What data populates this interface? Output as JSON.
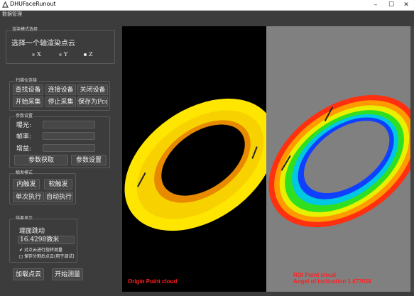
{
  "window": {
    "title": "DHUFaceRunout"
  },
  "menu": {
    "items": [
      "数据管理"
    ]
  },
  "render_mode": {
    "group_title": "渲染模式选择",
    "prompt": "选择一个轴渲染点云",
    "options": [
      "X",
      "Y",
      "Z"
    ],
    "selected": "Z"
  },
  "scanner": {
    "group_title": "扫描仪连接",
    "buttons": {
      "find": "查找设备",
      "connect": "连接设备",
      "close": "关闭设备",
      "start_capture": "开始采集",
      "stop_capture": "停止采集",
      "save_pcd": "保存为Pcd"
    }
  },
  "params": {
    "group_title": "参数设置",
    "exposure_label": "曝光:",
    "framerate_label": "帧率:",
    "gain_label": "增益:",
    "exposure_value": "",
    "framerate_value": "",
    "gain_value": "",
    "get_button": "参数获取",
    "set_button": "参数设置"
  },
  "trigger": {
    "group_title": "触发模式",
    "internal": "内触发",
    "software": "软触发",
    "single": "单次执行",
    "auto": "自动执行"
  },
  "result": {
    "group_title": "结果显示",
    "metric_label": "端面跳动",
    "metric_value": "16.4298微米",
    "rotate_check": "对点云进行旋转测量",
    "save_check": "保存分割后点云(用于调试)",
    "rotate_checked": true,
    "save_checked": false
  },
  "actions": {
    "load": "加载点云",
    "measure": "开始测量"
  },
  "viewers": {
    "origin_label": "Origin Point cloud",
    "roi_label": "ROI Point cloud",
    "angle_label": "Angel of Inclination 1.477028"
  },
  "colors": {
    "label_red": "#ff2020",
    "viewer_left_bg": "#000000",
    "viewer_right_bg": "#808080"
  }
}
